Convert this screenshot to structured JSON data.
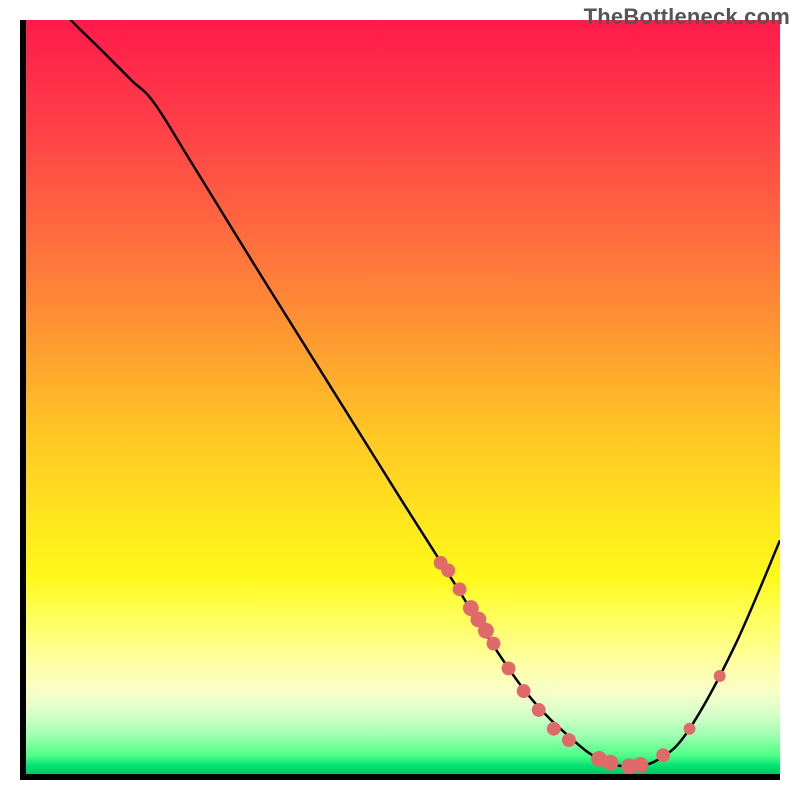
{
  "watermark": "TheBottleneck.com",
  "chart_data": {
    "type": "line",
    "title": "",
    "xlabel": "",
    "ylabel": "",
    "xlim": [
      0,
      100
    ],
    "ylim": [
      0,
      100
    ],
    "grid": false,
    "curve_points": [
      {
        "x": 0,
        "y": 107
      },
      {
        "x": 5,
        "y": 101
      },
      {
        "x": 10,
        "y": 96
      },
      {
        "x": 14,
        "y": 92
      },
      {
        "x": 17,
        "y": 89
      },
      {
        "x": 22,
        "y": 81
      },
      {
        "x": 30,
        "y": 68
      },
      {
        "x": 40,
        "y": 52
      },
      {
        "x": 50,
        "y": 36
      },
      {
        "x": 57,
        "y": 25
      },
      {
        "x": 62,
        "y": 17
      },
      {
        "x": 67,
        "y": 10
      },
      {
        "x": 72,
        "y": 5
      },
      {
        "x": 76,
        "y": 2
      },
      {
        "x": 80,
        "y": 1
      },
      {
        "x": 84,
        "y": 2
      },
      {
        "x": 88,
        "y": 6
      },
      {
        "x": 94,
        "y": 17
      },
      {
        "x": 100,
        "y": 31
      }
    ],
    "marker_points": [
      {
        "x": 55,
        "y": 28,
        "r": 7
      },
      {
        "x": 56,
        "y": 27,
        "r": 7
      },
      {
        "x": 57.5,
        "y": 24.5,
        "r": 7
      },
      {
        "x": 59,
        "y": 22,
        "r": 8
      },
      {
        "x": 60,
        "y": 20.5,
        "r": 8
      },
      {
        "x": 61,
        "y": 19,
        "r": 8
      },
      {
        "x": 62,
        "y": 17.3,
        "r": 7
      },
      {
        "x": 64,
        "y": 14,
        "r": 7
      },
      {
        "x": 66,
        "y": 11,
        "r": 7
      },
      {
        "x": 68,
        "y": 8.5,
        "r": 7
      },
      {
        "x": 70,
        "y": 6,
        "r": 7
      },
      {
        "x": 72,
        "y": 4.5,
        "r": 7
      },
      {
        "x": 76,
        "y": 2,
        "r": 8
      },
      {
        "x": 77.5,
        "y": 1.5,
        "r": 8
      },
      {
        "x": 80,
        "y": 1,
        "r": 8
      },
      {
        "x": 81.5,
        "y": 1.2,
        "r": 8
      },
      {
        "x": 84.5,
        "y": 2.5,
        "r": 7
      },
      {
        "x": 88,
        "y": 6,
        "r": 6
      },
      {
        "x": 92,
        "y": 13,
        "r": 6
      }
    ],
    "marker_color": "#e06a6a",
    "gradient": {
      "top": "#ff1a4a",
      "mid": "#ffe51e",
      "bottom": "#00e070"
    }
  }
}
